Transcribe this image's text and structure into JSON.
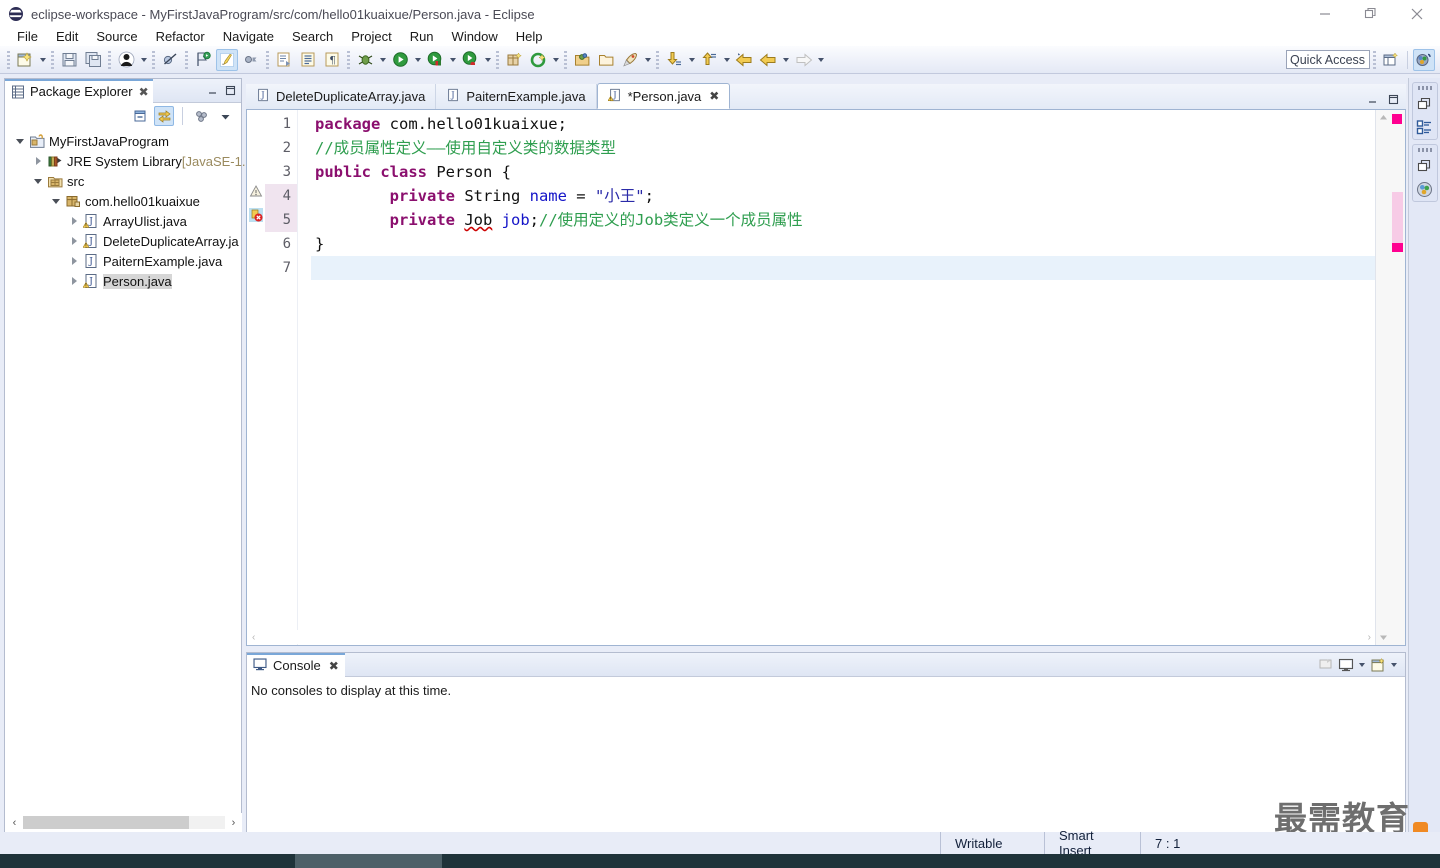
{
  "window": {
    "title": "eclipse-workspace - MyFirstJavaProgram/src/com/hello01kuaixue/Person.java - Eclipse",
    "minimize_label": "—",
    "restore_label": "❐",
    "close_label": "✕"
  },
  "menubar": {
    "items": [
      {
        "label": "File"
      },
      {
        "label": "Edit"
      },
      {
        "label": "Source"
      },
      {
        "label": "Refactor"
      },
      {
        "label": "Navigate"
      },
      {
        "label": "Search"
      },
      {
        "label": "Project"
      },
      {
        "label": "Run"
      },
      {
        "label": "Window"
      },
      {
        "label": "Help"
      }
    ]
  },
  "toolbar": {
    "quick_access_placeholder": "Quick Access",
    "icons": [
      "new-wizard-icon",
      "save-icon",
      "save-all-icon",
      "user-icon",
      "toggle-breakpoint-icon",
      "skip-breakpoints-icon",
      "edit-highlight-icon",
      "next-annotation-icon",
      "open-type-icon",
      "open-task-icon",
      "pilcrow-icon",
      "debug-icon",
      "run-icon",
      "run-coverage-icon",
      "run-external-icon",
      "new-java-package-icon",
      "new-class-icon",
      "open-type-search-icon",
      "open-task-folder-icon",
      "search-icon",
      "next-edit-icon",
      "previous-edit-icon",
      "back-icon",
      "forward-icon"
    ],
    "perspective": {
      "open_perspective_icon": "open-perspective-icon",
      "java_perspective_icon": "java-perspective-icon"
    }
  },
  "package_explorer": {
    "tab_label": "Package Explorer",
    "tab_close": "✖",
    "tools": [
      "collapse-all-icon",
      "link-with-editor-icon",
      "view-menu-icon",
      "view-dropdown-icon"
    ],
    "minimize_icon": "minimize-icon",
    "maximize_icon": "maximize-icon",
    "tree": [
      {
        "label": "MyFirstJavaProgram",
        "depth": 0,
        "twisty": "expanded",
        "icon": "java-project-icon",
        "suffix": "",
        "selected": false
      },
      {
        "label": "JRE System Library",
        "depth": 1,
        "twisty": "collapsed",
        "icon": "library-icon",
        "suffix": " [JavaSE-1.",
        "selected": false
      },
      {
        "label": "src",
        "depth": 1,
        "twisty": "expanded",
        "icon": "source-folder-icon",
        "suffix": "",
        "selected": false
      },
      {
        "label": "com.hello01kuaixue",
        "depth": 2,
        "twisty": "expanded",
        "icon": "package-icon",
        "suffix": "",
        "selected": false
      },
      {
        "label": "ArrayUlist.java",
        "depth": 3,
        "twisty": "collapsed",
        "icon": "java-file-warning-icon",
        "suffix": "",
        "selected": false
      },
      {
        "label": "DeleteDuplicateArray.ja",
        "depth": 3,
        "twisty": "collapsed",
        "icon": "java-file-warning-icon",
        "suffix": "",
        "selected": false
      },
      {
        "label": "PaiternExample.java",
        "depth": 3,
        "twisty": "collapsed",
        "icon": "java-file-icon",
        "suffix": "",
        "selected": false
      },
      {
        "label": "Person.java",
        "depth": 3,
        "twisty": "collapsed",
        "icon": "java-file-warning-icon",
        "suffix": "",
        "selected": true
      }
    ],
    "hscroll_left": "‹",
    "hscroll_right": "›"
  },
  "editor": {
    "tabs": [
      {
        "label": "DeleteDuplicateArray.java",
        "active": false,
        "dirty": false,
        "icon": "java-file-icon",
        "close": ""
      },
      {
        "label": "PaiternExample.java",
        "active": false,
        "dirty": false,
        "icon": "java-file-icon",
        "close": ""
      },
      {
        "label": "*Person.java",
        "active": true,
        "dirty": true,
        "icon": "java-file-warning-icon",
        "close": "✖"
      }
    ],
    "line_numbers": [
      "1",
      "2",
      "3",
      "4",
      "5",
      "6",
      "7"
    ],
    "current_line": 7,
    "markers": [
      {
        "line": 4,
        "type": "warning-marker-icon"
      },
      {
        "line": 5,
        "type": "error-marker-icon"
      }
    ],
    "code_lines": [
      {
        "n": 1,
        "tokens": [
          {
            "t": "package",
            "c": "kw"
          },
          {
            "t": " com.hello01kuaixue;",
            "c": "plain"
          }
        ]
      },
      {
        "n": 2,
        "tokens": [
          {
            "t": "//成员属性定义——使用自定义类的数据类型",
            "c": "cmt"
          }
        ]
      },
      {
        "n": 3,
        "tokens": [
          {
            "t": "public",
            "c": "kw"
          },
          {
            "t": " ",
            "c": "plain"
          },
          {
            "t": "class",
            "c": "kw"
          },
          {
            "t": " Person {",
            "c": "plain"
          }
        ]
      },
      {
        "n": 4,
        "tokens": [
          {
            "t": "        ",
            "c": "plain"
          },
          {
            "t": "private",
            "c": "kw"
          },
          {
            "t": " String ",
            "c": "plain"
          },
          {
            "t": "name",
            "c": "fld"
          },
          {
            "t": " = ",
            "c": "plain"
          },
          {
            "t": "\"小王\"",
            "c": "str"
          },
          {
            "t": ";",
            "c": "plain"
          }
        ]
      },
      {
        "n": 5,
        "tokens": [
          {
            "t": "        ",
            "c": "plain"
          },
          {
            "t": "private",
            "c": "kw"
          },
          {
            "t": " ",
            "c": "plain"
          },
          {
            "t": "Job",
            "c": "plain err-underline"
          },
          {
            "t": " ",
            "c": "plain"
          },
          {
            "t": "job",
            "c": "fld"
          },
          {
            "t": ";",
            "c": "plain"
          },
          {
            "t": "//使用定义的Job类定义一个成员属性",
            "c": "cmt"
          }
        ]
      },
      {
        "n": 6,
        "tokens": [
          {
            "t": "}",
            "c": "plain"
          }
        ]
      },
      {
        "n": 7,
        "tokens": [
          {
            "t": "",
            "c": "plain"
          }
        ]
      }
    ],
    "overview_marker_color": "#ff0090",
    "hscroll_left": "‹",
    "hscroll_right": "›",
    "vscroll_up": "▲",
    "vscroll_down": "▼"
  },
  "right_bar": {
    "groups": [
      {
        "icons": [
          "restore-icon",
          "outline-view-icon"
        ]
      },
      {
        "icons": [
          "restore-icon",
          "package-explorer-view-icon"
        ]
      }
    ]
  },
  "console": {
    "tab_label": "Console",
    "tab_close": "✖",
    "icon": "console-icon",
    "message": "No consoles to display at this time.",
    "tools": [
      "clear-console-icon",
      "display-selected-console-icon",
      "open-console-icon"
    ]
  },
  "statusbar": {
    "writable": "Writable",
    "insert_mode": "Smart Insert",
    "position": "7 : 1"
  },
  "watermark": {
    "text": "最需教育",
    "badge": "rss-icon"
  },
  "colors": {
    "keyword": "#8b0f6e",
    "comment": "#2f9e4f",
    "string": "#2a2aa8",
    "field": "#1414c8",
    "accent": "#7aa7d8",
    "marker": "#ff0090"
  }
}
